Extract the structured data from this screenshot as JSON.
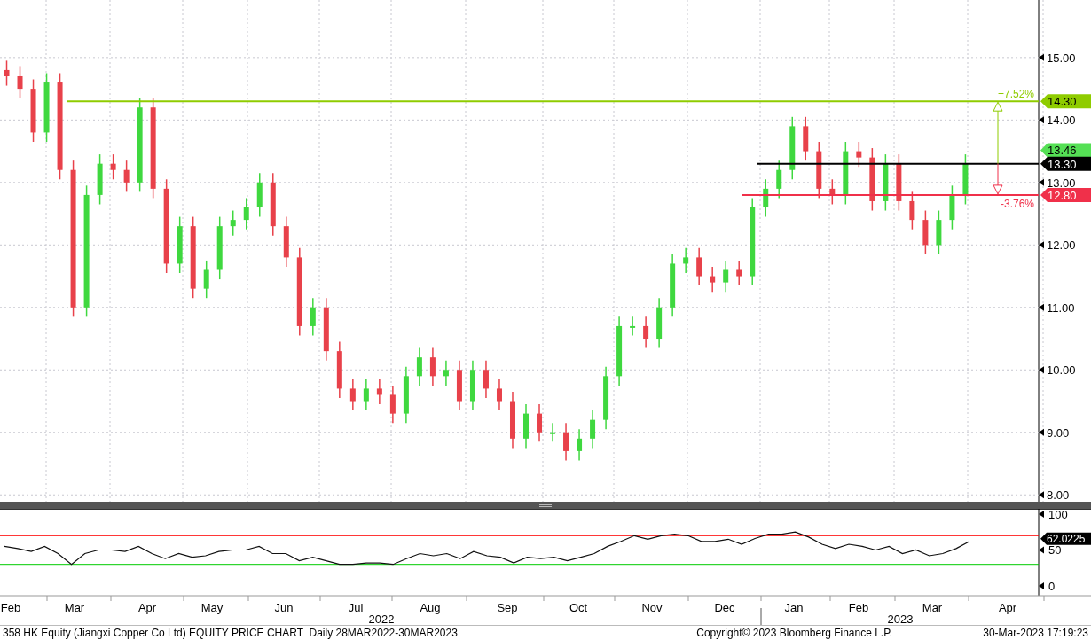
{
  "price_chart": {
    "chart_data": {
      "type": "candlestick",
      "grid": true,
      "ref_lines": [
        {
          "axis": "y",
          "value": 14.3,
          "color": "#8fcc00"
        },
        {
          "axis": "y",
          "value": 13.3,
          "color": "#000000"
        },
        {
          "axis": "y",
          "value": 12.8,
          "color": "#f0304a"
        }
      ],
      "ylim": [
        7.89,
        15.92
      ],
      "yticks": [
        {
          "value": 8,
          "label": "8.00"
        },
        {
          "value": 9,
          "label": "9.00"
        },
        {
          "value": 10,
          "label": "10.00"
        },
        {
          "value": 11,
          "label": "11.00"
        },
        {
          "value": 12,
          "label": "12.00"
        },
        {
          "value": 13,
          "label": "13.00"
        },
        {
          "value": 14,
          "label": "14.00"
        },
        {
          "value": 15,
          "label": "15.00"
        }
      ],
      "categories": [
        null,
        null,
        null,
        null,
        null,
        null,
        null,
        null,
        null,
        null,
        null,
        null,
        null,
        null,
        null,
        null,
        null,
        null,
        null,
        null,
        null,
        null,
        null,
        null,
        null,
        null,
        null,
        null,
        null,
        null,
        null,
        null,
        null,
        null,
        null,
        null,
        null,
        null,
        null,
        null,
        null,
        null,
        null,
        null,
        null,
        null,
        null,
        null,
        null,
        null,
        null,
        null,
        null,
        null,
        null,
        null,
        null,
        null,
        null,
        null,
        null,
        null,
        null,
        null,
        null,
        null,
        null,
        null,
        null,
        null,
        null,
        null,
        null,
        null,
        null,
        null,
        null,
        null
      ],
      "ohlc": [
        [
          14.8,
          14.95,
          14.55,
          14.7
        ],
        [
          14.7,
          14.85,
          14.35,
          14.5
        ],
        [
          14.5,
          14.65,
          13.65,
          13.8
        ],
        [
          13.8,
          14.75,
          13.65,
          14.6
        ],
        [
          14.6,
          14.75,
          13.05,
          13.2
        ],
        [
          13.2,
          13.35,
          10.85,
          11.0
        ],
        [
          11.0,
          12.95,
          10.85,
          12.8
        ],
        [
          12.8,
          13.45,
          12.65,
          13.3
        ],
        [
          13.3,
          13.45,
          13.05,
          13.2
        ],
        [
          13.2,
          13.35,
          12.85,
          13.0
        ],
        [
          13.0,
          14.35,
          12.85,
          14.2
        ],
        [
          14.2,
          14.35,
          12.75,
          12.9
        ],
        [
          12.9,
          13.05,
          11.55,
          11.7
        ],
        [
          11.7,
          12.45,
          11.55,
          12.3
        ],
        [
          12.3,
          12.45,
          11.15,
          11.3
        ],
        [
          11.3,
          11.75,
          11.15,
          11.6
        ],
        [
          11.6,
          12.45,
          11.45,
          12.3
        ],
        [
          12.3,
          12.55,
          12.15,
          12.4
        ],
        [
          12.4,
          12.75,
          12.25,
          12.6
        ],
        [
          12.6,
          13.15,
          12.45,
          13.0
        ],
        [
          13.0,
          13.15,
          12.15,
          12.3
        ],
        [
          12.3,
          12.45,
          11.65,
          11.8
        ],
        [
          11.8,
          11.95,
          10.55,
          10.7
        ],
        [
          10.7,
          11.15,
          10.55,
          11.0
        ],
        [
          11.0,
          11.15,
          10.15,
          10.3
        ],
        [
          10.3,
          10.45,
          9.55,
          9.7
        ],
        [
          9.7,
          9.85,
          9.35,
          9.5
        ],
        [
          9.5,
          9.85,
          9.35,
          9.7
        ],
        [
          9.7,
          9.85,
          9.45,
          9.6
        ],
        [
          9.6,
          9.75,
          9.15,
          9.3
        ],
        [
          9.3,
          10.05,
          9.15,
          9.9
        ],
        [
          9.9,
          10.35,
          9.75,
          10.2
        ],
        [
          10.2,
          10.35,
          9.75,
          9.9
        ],
        [
          9.9,
          10.15,
          9.75,
          10.0
        ],
        [
          10.0,
          10.15,
          9.35,
          9.5
        ],
        [
          9.5,
          10.15,
          9.35,
          10.0
        ],
        [
          10.0,
          10.15,
          9.55,
          9.7
        ],
        [
          9.7,
          9.85,
          9.35,
          9.5
        ],
        [
          9.5,
          9.65,
          8.75,
          8.9
        ],
        [
          8.9,
          9.45,
          8.75,
          9.3
        ],
        [
          9.3,
          9.45,
          8.85,
          9.0
        ],
        [
          9.0,
          9.15,
          8.85,
          9.0
        ],
        [
          9.0,
          9.15,
          8.55,
          8.7
        ],
        [
          8.7,
          9.05,
          8.55,
          8.9
        ],
        [
          8.9,
          9.35,
          8.75,
          9.2
        ],
        [
          9.2,
          10.05,
          9.05,
          9.9
        ],
        [
          9.9,
          10.85,
          9.75,
          10.7
        ],
        [
          10.7,
          10.85,
          10.55,
          10.7
        ],
        [
          10.7,
          10.85,
          10.35,
          10.5
        ],
        [
          10.5,
          11.15,
          10.35,
          11.0
        ],
        [
          11.0,
          11.85,
          10.85,
          11.7
        ],
        [
          11.7,
          11.95,
          11.55,
          11.8
        ],
        [
          11.8,
          11.95,
          11.35,
          11.5
        ],
        [
          11.5,
          11.65,
          11.25,
          11.4
        ],
        [
          11.4,
          11.75,
          11.25,
          11.6
        ],
        [
          11.6,
          11.75,
          11.35,
          11.5
        ],
        [
          11.5,
          12.75,
          11.35,
          12.6
        ],
        [
          12.6,
          13.05,
          12.45,
          12.9
        ],
        [
          12.9,
          13.35,
          12.75,
          13.2
        ],
        [
          13.2,
          14.05,
          13.05,
          13.9
        ],
        [
          13.9,
          14.05,
          13.35,
          13.5
        ],
        [
          13.5,
          13.65,
          12.75,
          12.9
        ],
        [
          12.9,
          13.05,
          12.65,
          12.8
        ],
        [
          12.8,
          13.65,
          12.65,
          13.5
        ],
        [
          13.5,
          13.65,
          13.25,
          13.4
        ],
        [
          13.4,
          13.55,
          12.55,
          12.7
        ],
        [
          12.7,
          13.45,
          12.55,
          13.3
        ],
        [
          13.3,
          13.45,
          12.55,
          12.7
        ],
        [
          12.7,
          12.85,
          12.25,
          12.4
        ],
        [
          12.4,
          12.55,
          11.85,
          12.0
        ],
        [
          12.0,
          12.55,
          11.85,
          12.4
        ],
        [
          12.4,
          12.95,
          12.25,
          12.8
        ],
        [
          12.8,
          13.45,
          12.65,
          13.3
        ],
        null,
        null,
        null,
        null,
        null
      ]
    },
    "levels": [
      {
        "kind": "upper",
        "label": "14.30",
        "change": "+7.52%",
        "color": "#8fcc00"
      },
      {
        "kind": "last",
        "label": "13.30",
        "color": "#000000"
      },
      {
        "kind": "lower",
        "label": "12.80",
        "change": "-3.76%",
        "color": "#f0304a"
      }
    ],
    "last_high_tag": {
      "label": "13.46"
    }
  },
  "rsi_chart": {
    "chart_data": {
      "type": "line",
      "ylim": [
        -13.6,
        107.4
      ],
      "yticks": [
        {
          "value": 0,
          "label": "0"
        },
        {
          "value": 50,
          "label": "50"
        },
        {
          "value": 100,
          "label": "100"
        }
      ],
      "categories": [
        null,
        null,
        null,
        null,
        null,
        null,
        null,
        null,
        null,
        null,
        null,
        null,
        null,
        null,
        null,
        null,
        null,
        null,
        null,
        null,
        null,
        null,
        null,
        null,
        null,
        null,
        null,
        null,
        null,
        null,
        null,
        null,
        null,
        null,
        null,
        null,
        null,
        null,
        null,
        null,
        null,
        null,
        null,
        null,
        null,
        null,
        null,
        null,
        null,
        null,
        null,
        null,
        null,
        null,
        null,
        null,
        null,
        null,
        null,
        null,
        null,
        null,
        null,
        null,
        null,
        null,
        null,
        null,
        null,
        null,
        null,
        null,
        null
      ],
      "series": [
        {
          "color": "#111111",
          "values": [
            55,
            52,
            48,
            55,
            45,
            30,
            45,
            50,
            50,
            48,
            55,
            45,
            38,
            45,
            40,
            42,
            48,
            50,
            50,
            55,
            45,
            45,
            35,
            40,
            35,
            30,
            30,
            32,
            32,
            30,
            38,
            45,
            42,
            45,
            38,
            48,
            42,
            40,
            32,
            40,
            38,
            40,
            35,
            40,
            45,
            55,
            62,
            70,
            65,
            70,
            72,
            70,
            62,
            62,
            65,
            58,
            66,
            72,
            72,
            75,
            68,
            58,
            52,
            58,
            55,
            50,
            55,
            45,
            50,
            42,
            45,
            52,
            62
          ]
        }
      ],
      "ref_lines": [
        {
          "axis": "y",
          "value": 70,
          "color": "#ff0000"
        },
        {
          "axis": "y",
          "value": 30,
          "color": "#00cc00"
        }
      ]
    },
    "last_value": "62.0225"
  },
  "x_axis": {
    "months": [
      "Feb",
      "Mar",
      "Apr",
      "May",
      "Jun",
      "Jul",
      "Aug",
      "Sep",
      "Oct",
      "Nov",
      "Dec",
      "Jan",
      "Feb",
      "Mar",
      "Apr"
    ],
    "years": [
      "2022",
      "2023"
    ]
  },
  "footer": {
    "title": "358 HK Equity (Jiangxi Copper Co Ltd) EQUITY PRICE CHART  Daily 28MAR2022-30MAR2023",
    "copyright": "Copyright© 2023 Bloomberg Finance L.P.",
    "timestamp": "30-Mar-2023 17:19:23"
  }
}
